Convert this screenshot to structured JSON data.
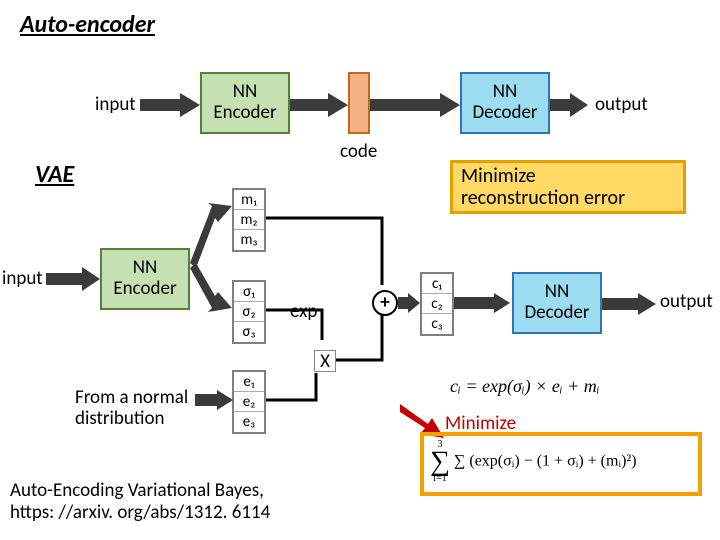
{
  "title": "Auto-encoder",
  "top_row": {
    "input": "input",
    "encoder": "NN\nEncoder",
    "code": "code",
    "decoder": "NN\nDecoder",
    "output": "output"
  },
  "vae_title": "VAE",
  "vae": {
    "input": "input",
    "encoder": "NN\nEncoder",
    "m": [
      "m₁",
      "m₂",
      "m₃"
    ],
    "sigma": [
      "σ₁",
      "σ₂",
      "σ₃"
    ],
    "e": [
      "e₁",
      "e₂",
      "e₃"
    ],
    "c": [
      "c₁",
      "c₂",
      "c₃"
    ],
    "exp": "exp",
    "plus": "+",
    "times": "X",
    "decoder": "NN\nDecoder",
    "output": "output"
  },
  "minimize_box": "Minimize\nreconstruction error",
  "normal_label": "From a normal\ndistribution",
  "minimize2": "Minimize",
  "formula_c": "cᵢ = exp(σᵢ) × eᵢ + mᵢ",
  "formula_sum": "∑ (exp(σᵢ) − (1 + σᵢ) + (mᵢ)²)",
  "sum_limits": {
    "top": "3",
    "bottom": "i=1"
  },
  "footer": "Auto-Encoding Variational Bayes,\nhttps: //arxiv. org/abs/1312. 6114"
}
